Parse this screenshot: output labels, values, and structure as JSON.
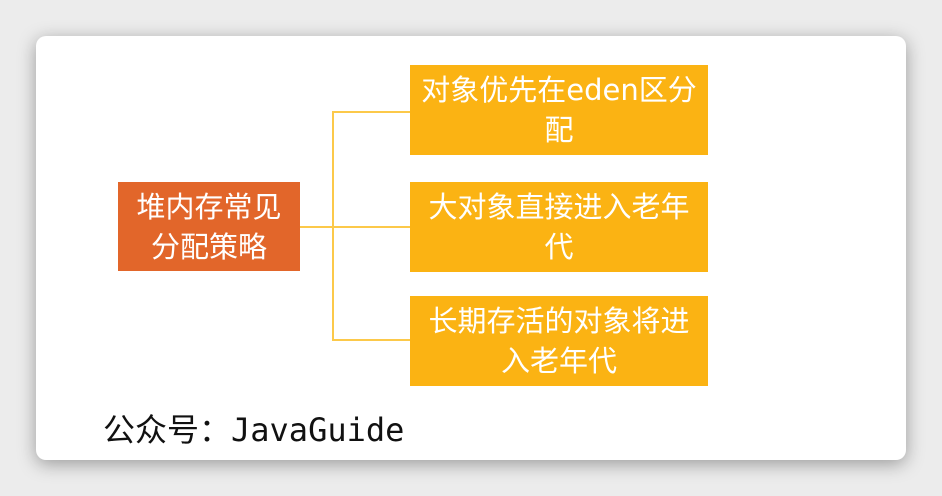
{
  "root": {
    "label": "堆内存常见分配策略"
  },
  "children": [
    {
      "label": "对象优先在eden区分配"
    },
    {
      "label": "大对象直接进入老年代"
    },
    {
      "label": "长期存活的对象将进入老年代"
    }
  ],
  "footer": "公众号：JavaGuide",
  "colors": {
    "root": "#e2662a",
    "child": "#fbb313",
    "connector": "#fcc94a"
  }
}
